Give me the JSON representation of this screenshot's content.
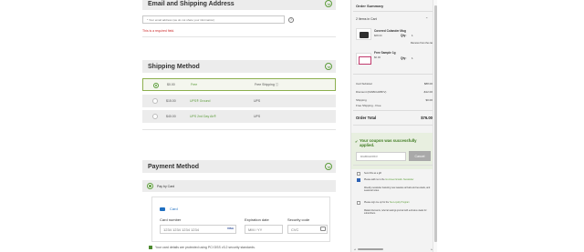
{
  "email_section": {
    "title": "Email and Shipping Address",
    "email_placeholder": "* Your email address (we do not share your information)",
    "error": "This is a required field."
  },
  "shipping_section": {
    "title": "Shipping Method",
    "options": [
      {
        "price": "$0.00",
        "name": "Free",
        "carrier": "Free Shipping ⓘ",
        "selected": true
      },
      {
        "price": "$15.00",
        "name": "UPS® Ground",
        "carrier": "UPS",
        "selected": false
      },
      {
        "price": "$40.00",
        "name": "UPS 2nd Day Air®",
        "carrier": "UPS",
        "selected": false
      }
    ]
  },
  "payment_section": {
    "title": "Payment Method",
    "method_label": "Pay by Card",
    "card_title": "Card",
    "card_number_label": "Card number",
    "card_number_placeholder": "1234 1234 1234 1234",
    "card_brand": "VISA",
    "expiration_label": "Expiration date",
    "expiration_placeholder": "MM / YY",
    "cvc_label": "Security code",
    "cvc_placeholder": "CVC",
    "secure_note": "Your card details are protected using PCI DSS v3.2 security standards."
  },
  "summary": {
    "title": "Order Summary",
    "items_count": "2 Items in Cart",
    "items": [
      {
        "name": "Covered Colander Mug",
        "price": "$68.00",
        "qty_label": "Qty:",
        "qty": "1"
      },
      {
        "name": "Free Sample 1g",
        "price": "$0.00",
        "qty_label": "Qty:",
        "qty": "1"
      }
    ],
    "remove_label": "Remove from the cart",
    "lines": [
      {
        "label": "Cart Subtotal",
        "value": "$88.00"
      },
      {
        "label": "Discount (DIABCHF8KV)",
        "value": "-$12.00"
      },
      {
        "label": "Shipping",
        "value": "$0.00"
      },
      {
        "label": "Free Shipping - Free",
        "value": ""
      }
    ],
    "total_label": "Order Total",
    "total_value": "$76.00",
    "coupon_message": "Your coupon was successfully applied.",
    "coupon_code": "DIABCHF8KV",
    "cancel_label": "Cancel",
    "options": [
      {
        "text": "Send this as a gift",
        "checked": false
      },
      {
        "text": "Please add me to the ",
        "link": "Go-Green Emails. Newsletter",
        "checked": true
      },
      {
        "text": "Weekly newsletter featuring new teaware arrivals and tea deals, and seasonal notes.",
        "checked": false,
        "indent": true
      },
      {
        "text": "Please sign me up for the ",
        "link": "Tea Loyalty Program",
        "checked": false
      },
      {
        "text": "Mailed discounts, referral savings journal with exclusive deals for subscribers.",
        "checked": false,
        "indent": true
      }
    ]
  },
  "colors": {
    "accent": "#5d9d3b",
    "error": "#cc2b2b",
    "link": "#1f6fc1"
  }
}
